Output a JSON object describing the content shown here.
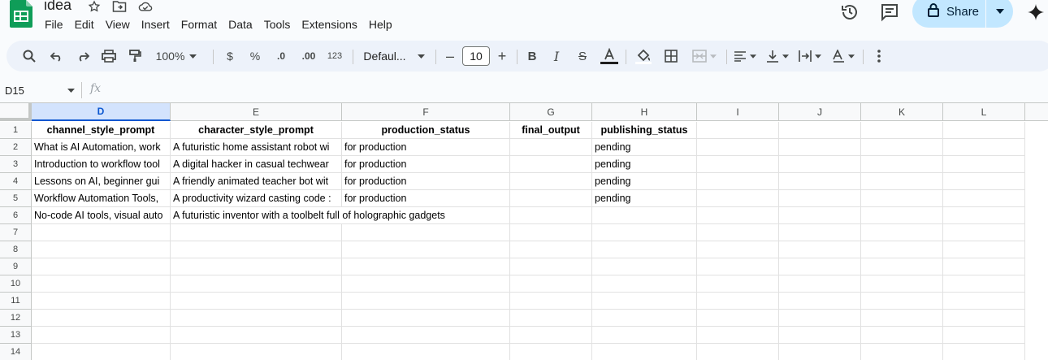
{
  "doc": {
    "title": "idea"
  },
  "menu": [
    "File",
    "Edit",
    "View",
    "Insert",
    "Format",
    "Data",
    "Tools",
    "Extensions",
    "Help"
  ],
  "share": {
    "label": "Share"
  },
  "toolbar": {
    "zoom": "100%",
    "currency": "$",
    "percent": "%",
    "decrease_decimal": ".0",
    "increase_decimal": ".00",
    "number_format": "123",
    "font": "Defaul...",
    "font_size": "10"
  },
  "formula_bar": {
    "name_box": "D15",
    "fx": "fx"
  },
  "grid": {
    "columns": [
      "D",
      "E",
      "F",
      "G",
      "H",
      "I",
      "J",
      "K",
      "L"
    ],
    "selected_column": "D",
    "row_numbers": [
      "1",
      "2",
      "3",
      "4",
      "5",
      "6",
      "7",
      "8",
      "9",
      "10",
      "11",
      "12",
      "13",
      "14"
    ],
    "header_row": [
      "channel_style_prompt",
      "character_style_prompt",
      "production_status",
      "final_output",
      "publishing_status"
    ],
    "rows": [
      [
        "What is AI Automation, work",
        "A futuristic home assistant robot wi",
        "for production",
        "",
        "pending"
      ],
      [
        "Introduction to workflow tool",
        "A digital hacker in casual techwear",
        "for production",
        "",
        "pending"
      ],
      [
        "Lessons on AI, beginner gui",
        "A friendly animated teacher bot wit",
        "for production",
        "",
        "pending"
      ],
      [
        "Workflow Automation Tools,",
        "A productivity wizard casting code :",
        "for production",
        "",
        "pending"
      ],
      [
        "No-code AI tools, visual auto",
        "A futuristic inventor with a toolbelt full of holographic gadgets",
        "",
        "",
        ""
      ]
    ]
  },
  "colors": {
    "accent": "#0b57d0",
    "share_bg": "#c2e7ff",
    "toolbar_bg": "#edf2fa",
    "sheets_green": "#0f9d58"
  }
}
